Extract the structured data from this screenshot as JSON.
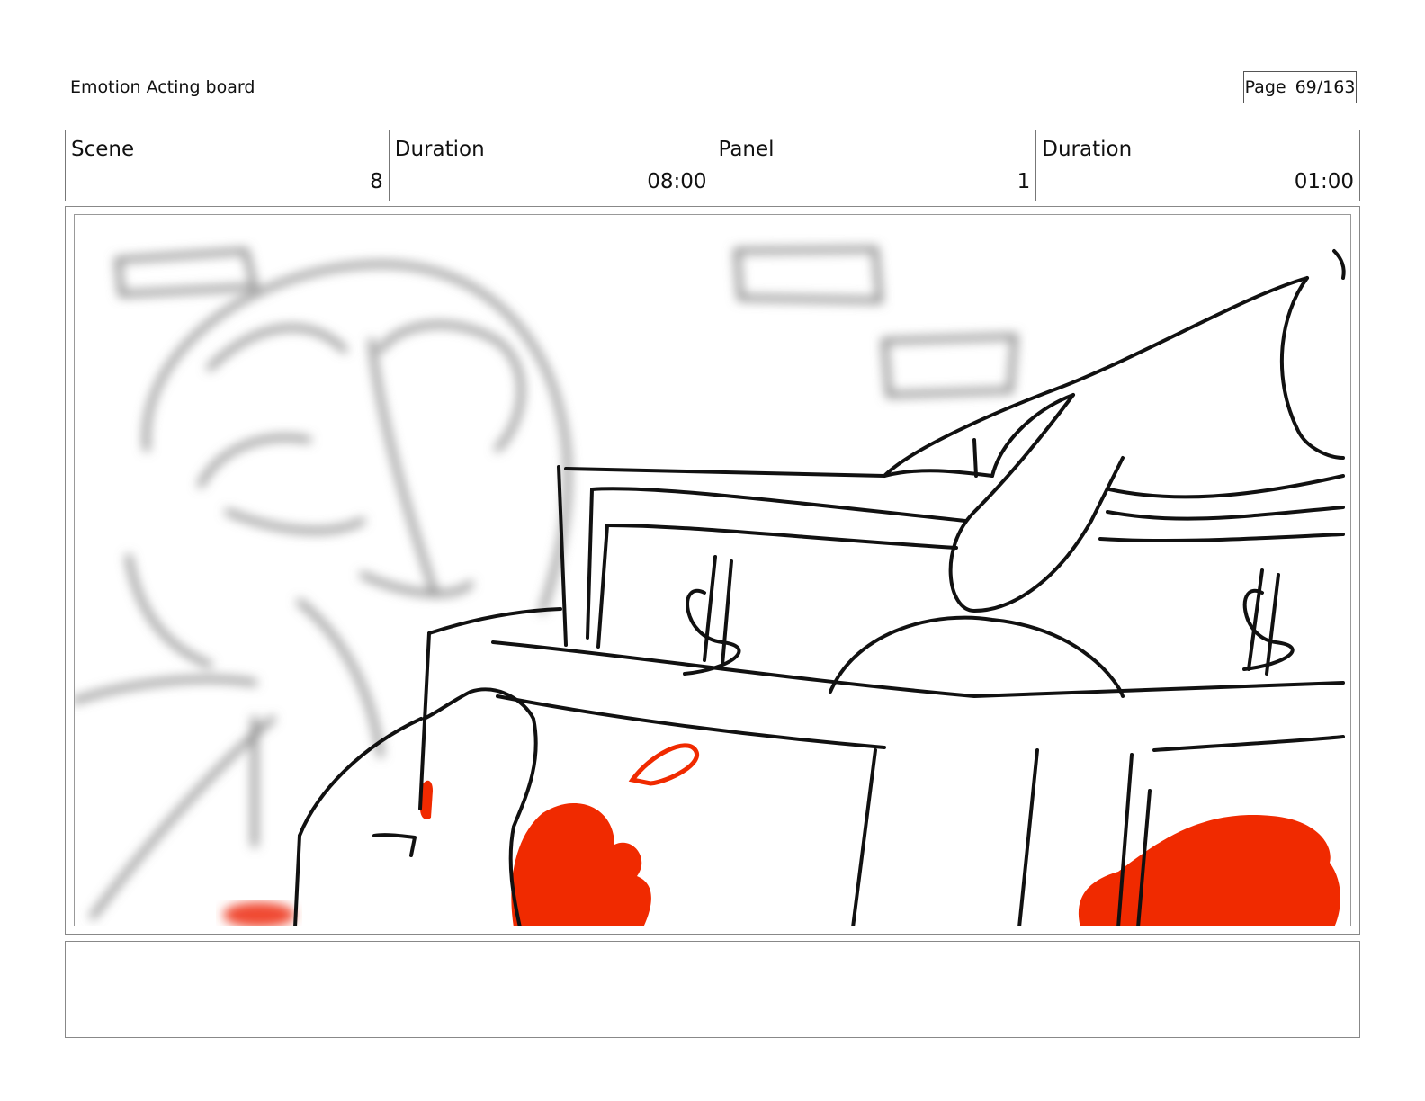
{
  "header": {
    "title": "Emotion Acting board",
    "page_label": "Page",
    "page_value": "69/163"
  },
  "info": {
    "scene_label": "Scene",
    "scene_value": "8",
    "scene_duration_label": "Duration",
    "scene_duration_value": "08:00",
    "panel_label": "Panel",
    "panel_value": "1",
    "panel_duration_label": "Duration",
    "panel_duration_value": "01:00"
  },
  "colors": {
    "ink": "#111111",
    "blur_ink": "#7a7a7a",
    "accent_red": "#f02a00"
  },
  "notes": {
    "text": ""
  }
}
